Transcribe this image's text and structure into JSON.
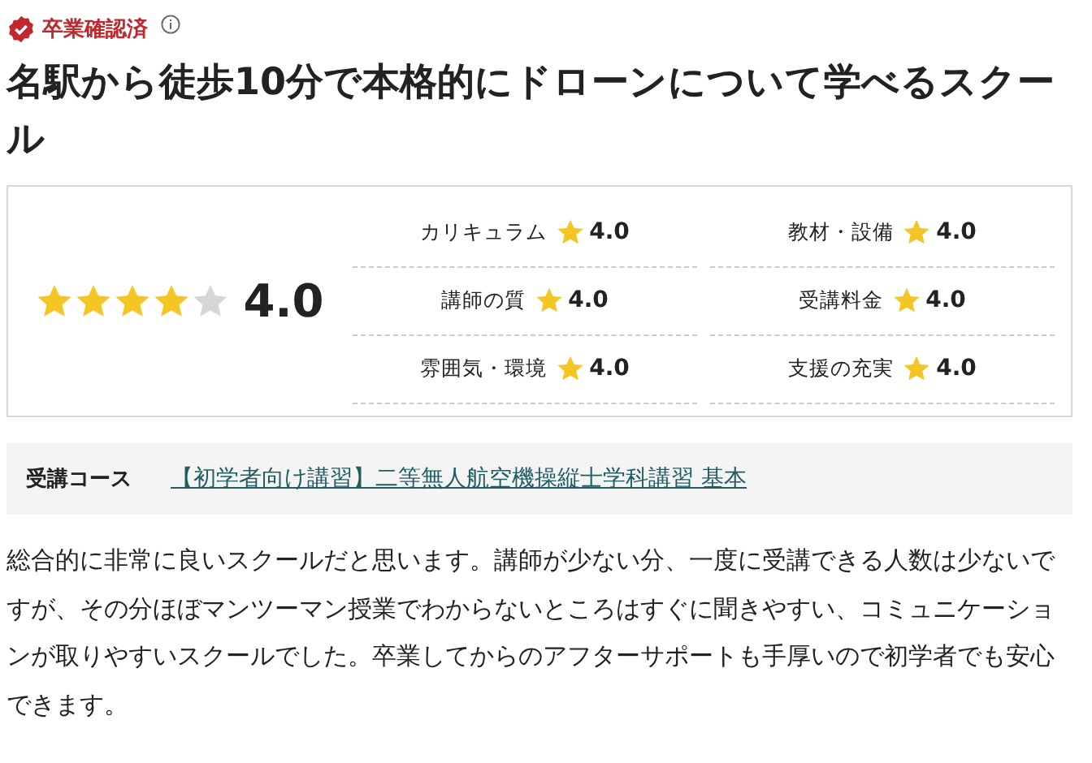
{
  "badge": {
    "label": "卒業確認済"
  },
  "title": "名駅から徒歩10分で本格的にドローンについて学べるスクール",
  "rating": {
    "stars": 4,
    "score": "4.0"
  },
  "sub_ratings": [
    {
      "label": "カリキュラム",
      "score": "4.0"
    },
    {
      "label": "教材・設備",
      "score": "4.0"
    },
    {
      "label": "講師の質",
      "score": "4.0"
    },
    {
      "label": "受講料金",
      "score": "4.0"
    },
    {
      "label": "雰囲気・環境",
      "score": "4.0"
    },
    {
      "label": "支援の充実",
      "score": "4.0"
    }
  ],
  "course": {
    "label": "受講コース",
    "link": "【初学者向け講習】二等無人航空機操縦士学科講習 基本"
  },
  "review": "総合的に非常に良いスクールだと思います。講師が少ない分、一度に受講できる人数は少ないですが、その分ほぼマンツーマン授業でわからないところはすぐに聞きやすい、コミュニケーションが取りやすいスクールでした。卒業してからのアフターサポートも手厚いので初学者でも安心できます。"
}
